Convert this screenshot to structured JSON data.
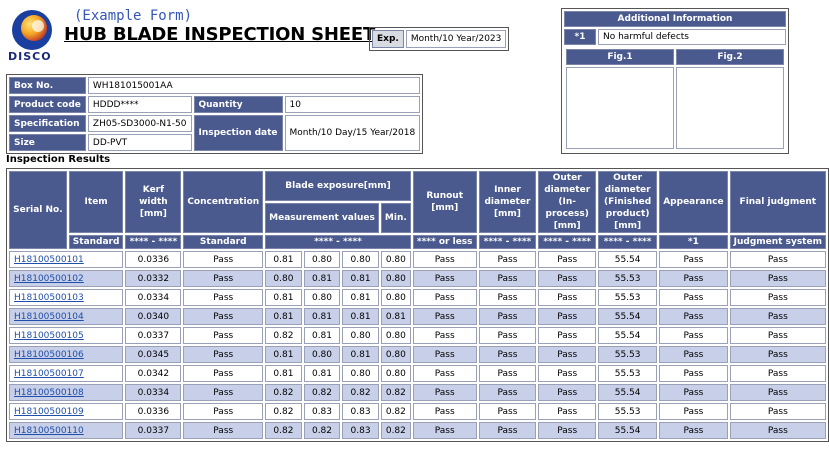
{
  "brand": {
    "example_label": "(Example Form)",
    "logo_text": "DISCO"
  },
  "sheet": {
    "title": "HUB BLADE INSPECTION SHEET",
    "exp_label": "Exp.",
    "exp_value": "Month/10 Year/2023"
  },
  "additional": {
    "title": "Additional Information",
    "note_key": "*1",
    "note_value": "No harmful defects",
    "fig1": "Fig.1",
    "fig2": "Fig.2"
  },
  "info": {
    "box_no_label": "Box No.",
    "box_no": "WH181015001AA",
    "product_code_label": "Product code",
    "product_code": "HDDD****",
    "quantity_label": "Quantity",
    "quantity": "10",
    "spec_label": "Specification",
    "spec": "ZH05-SD3000-N1-50",
    "insp_date_label": "Inspection date",
    "insp_date": "Month/10 Day/15 Year/2018",
    "size_label": "Size",
    "size": "DD-PVT"
  },
  "results": {
    "title": "Inspection Results",
    "headers": {
      "serial": "Serial No.",
      "item": "Item",
      "kerf": "Kerf width [mm]",
      "conc": "Concentration",
      "blade_exp": "Blade exposure[mm]",
      "meas": "Measurement values",
      "min": "Min.",
      "runout": "Runout [mm]",
      "inner": "Inner diameter [mm]",
      "outer_proc": "Outer diameter (In-process) [mm]",
      "outer_fin": "Outer diameter (Finished product) [mm]",
      "appearance": "Appearance",
      "final": "Final judgment"
    },
    "standards": {
      "item": "Standard",
      "kerf": "**** - ****",
      "conc": "Standard",
      "blade": "**** - ****",
      "runout": "**** or less",
      "inner": "**** - ****",
      "outer_proc": "**** - ****",
      "outer_fin": "**** - ****",
      "appearance": "*1",
      "final": "Judgment system"
    },
    "rows": [
      {
        "serial": "H18100500101",
        "kerf": "0.0336",
        "conc": "Pass",
        "m1": "0.81",
        "m2": "0.80",
        "m3": "0.80",
        "min": "0.80",
        "runout": "Pass",
        "inner": "Pass",
        "outer_proc": "Pass",
        "outer_fin": "55.54",
        "appearance": "Pass",
        "final": "Pass"
      },
      {
        "serial": "H18100500102",
        "kerf": "0.0332",
        "conc": "Pass",
        "m1": "0.80",
        "m2": "0.81",
        "m3": "0.81",
        "min": "0.80",
        "runout": "Pass",
        "inner": "Pass",
        "outer_proc": "Pass",
        "outer_fin": "55.53",
        "appearance": "Pass",
        "final": "Pass"
      },
      {
        "serial": "H18100500103",
        "kerf": "0.0334",
        "conc": "Pass",
        "m1": "0.81",
        "m2": "0.80",
        "m3": "0.81",
        "min": "0.80",
        "runout": "Pass",
        "inner": "Pass",
        "outer_proc": "Pass",
        "outer_fin": "55.53",
        "appearance": "Pass",
        "final": "Pass"
      },
      {
        "serial": "H18100500104",
        "kerf": "0.0340",
        "conc": "Pass",
        "m1": "0.81",
        "m2": "0.81",
        "m3": "0.81",
        "min": "0.81",
        "runout": "Pass",
        "inner": "Pass",
        "outer_proc": "Pass",
        "outer_fin": "55.54",
        "appearance": "Pass",
        "final": "Pass"
      },
      {
        "serial": "H18100500105",
        "kerf": "0.0337",
        "conc": "Pass",
        "m1": "0.82",
        "m2": "0.81",
        "m3": "0.80",
        "min": "0.80",
        "runout": "Pass",
        "inner": "Pass",
        "outer_proc": "Pass",
        "outer_fin": "55.54",
        "appearance": "Pass",
        "final": "Pass"
      },
      {
        "serial": "H18100500106",
        "kerf": "0.0345",
        "conc": "Pass",
        "m1": "0.81",
        "m2": "0.80",
        "m3": "0.81",
        "min": "0.80",
        "runout": "Pass",
        "inner": "Pass",
        "outer_proc": "Pass",
        "outer_fin": "55.53",
        "appearance": "Pass",
        "final": "Pass"
      },
      {
        "serial": "H18100500107",
        "kerf": "0.0342",
        "conc": "Pass",
        "m1": "0.81",
        "m2": "0.81",
        "m3": "0.80",
        "min": "0.80",
        "runout": "Pass",
        "inner": "Pass",
        "outer_proc": "Pass",
        "outer_fin": "55.53",
        "appearance": "Pass",
        "final": "Pass"
      },
      {
        "serial": "H18100500108",
        "kerf": "0.0334",
        "conc": "Pass",
        "m1": "0.82",
        "m2": "0.82",
        "m3": "0.82",
        "min": "0.82",
        "runout": "Pass",
        "inner": "Pass",
        "outer_proc": "Pass",
        "outer_fin": "55.54",
        "appearance": "Pass",
        "final": "Pass"
      },
      {
        "serial": "H18100500109",
        "kerf": "0.0336",
        "conc": "Pass",
        "m1": "0.82",
        "m2": "0.83",
        "m3": "0.83",
        "min": "0.82",
        "runout": "Pass",
        "inner": "Pass",
        "outer_proc": "Pass",
        "outer_fin": "55.53",
        "appearance": "Pass",
        "final": "Pass"
      },
      {
        "serial": "H18100500110",
        "kerf": "0.0337",
        "conc": "Pass",
        "m1": "0.82",
        "m2": "0.82",
        "m3": "0.83",
        "min": "0.82",
        "runout": "Pass",
        "inner": "Pass",
        "outer_proc": "Pass",
        "outer_fin": "55.54",
        "appearance": "Pass",
        "final": "Pass"
      }
    ]
  },
  "colors": {
    "header_bg": "#4a5a8e",
    "alt_row": "#c8cfe8",
    "link": "#1f4fa8",
    "title_blue": "#3456b8"
  }
}
